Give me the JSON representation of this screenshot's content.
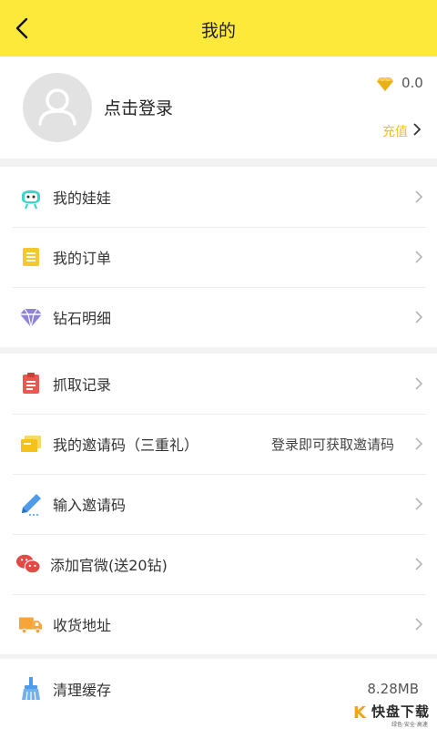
{
  "header": {
    "title": "我的"
  },
  "profile": {
    "login_text": "点击登录",
    "balance": "0.0",
    "recharge_label": "充值"
  },
  "menu_group_1": [
    {
      "label": "我的娃娃",
      "icon": "doll-face-icon"
    },
    {
      "label": "我的订单",
      "icon": "order-list-icon"
    },
    {
      "label": "钻石明细",
      "icon": "diamond-icon"
    }
  ],
  "menu_group_2": [
    {
      "label": "抓取记录",
      "icon": "clipboard-icon"
    },
    {
      "label": "我的邀请码（三重礼）",
      "icon": "tickets-icon",
      "extra": "登录即可获取邀请码"
    },
    {
      "label": "输入邀请码",
      "icon": "pencil-icon"
    },
    {
      "label": "添加官微(送20钻)",
      "icon": "wechat-icon"
    },
    {
      "label": "收货地址",
      "icon": "truck-icon"
    }
  ],
  "menu_group_3": [
    {
      "label": "清理缓存",
      "icon": "broom-icon",
      "extra": "8.28MB"
    }
  ],
  "watermark": {
    "brand_k": "K",
    "brand_text": "快盘下载",
    "brand_sub": "绿色·安全·高速"
  },
  "colors": {
    "header_bg": "#fde93a",
    "recharge": "#f0c315",
    "background": "#f2f2f2"
  }
}
